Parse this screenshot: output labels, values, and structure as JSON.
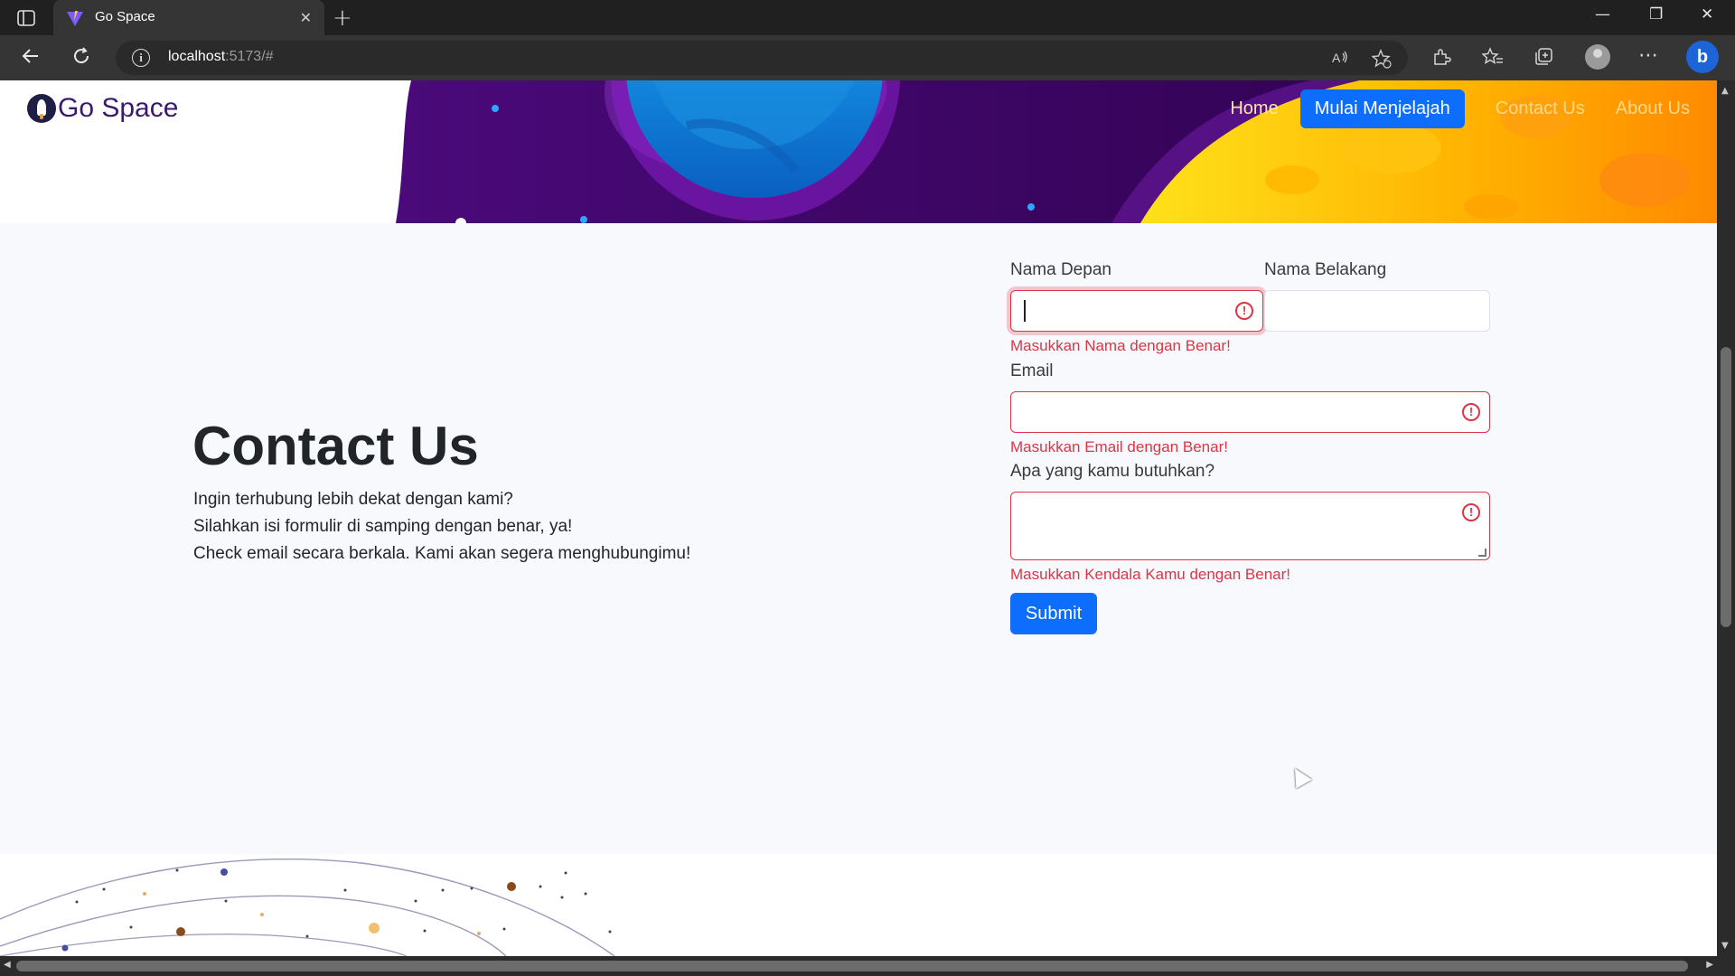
{
  "browser": {
    "tab_title": "Go Space",
    "url_host": "localhost",
    "url_rest": ":5173/#",
    "new_tab_symbol": "+",
    "tab_close_symbol": "✕",
    "window_minimize": "—",
    "window_restore": "❐",
    "window_close": "✕",
    "icons": [
      "tab-actions-icon",
      "back-icon",
      "refresh-icon",
      "site-info-icon",
      "read-aloud-icon",
      "add-favorite-icon",
      "extensions-icon",
      "favorites-icon",
      "collections-icon",
      "profile-icon",
      "more-icon",
      "copilot-icon"
    ]
  },
  "header": {
    "brand": "Go Space",
    "nav": {
      "home": "Home",
      "cta": "Mulai Menjelajah",
      "contact": "Contact Us",
      "about": "About Us"
    }
  },
  "contact": {
    "title": "Contact Us",
    "line1": "Ingin terhubung lebih dekat dengan kami?",
    "line2": "Silahkan isi formulir di samping dengan benar, ya!",
    "line3": "Check email secara berkala. Kami akan segera menghubungimu!"
  },
  "form": {
    "first_name_label": "Nama Depan",
    "first_name_value": "",
    "first_name_error": "Masukkan Nama dengan Benar!",
    "last_name_label": "Nama Belakang",
    "last_name_value": "",
    "email_label": "Email",
    "email_value": "",
    "email_error": "Masukkan Email dengan Benar!",
    "need_label": "Apa yang kamu butuhkan?",
    "need_value": "",
    "need_error": "Masukkan Kendala Kamu dengan Benar!",
    "submit_label": "Submit",
    "error_icon_glyph": "!"
  },
  "colors": {
    "primary": "#0d6efd",
    "danger": "#dc3545",
    "brand_text": "#3b1a6e",
    "page_bg": "#f8f9fc"
  }
}
